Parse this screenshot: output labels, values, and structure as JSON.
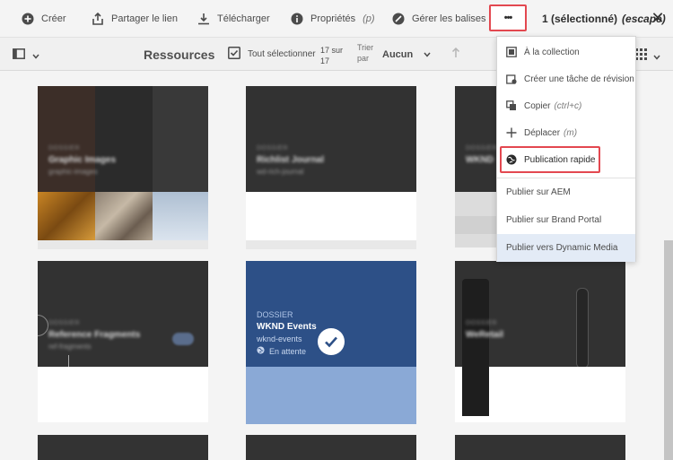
{
  "actionbar": {
    "create": "Créer",
    "share": "Partager le lien",
    "download": "Télécharger",
    "properties": "Propriétés",
    "properties_hint": "(p)",
    "tags": "Gérer les balises",
    "more": "•••",
    "selection": "1 (sélectionné)",
    "escape_hint": "(escape)",
    "close": "✕"
  },
  "toolbar": {
    "title": "Ressources",
    "select_all": "Tout sélectionner",
    "count": "17 sur 17",
    "sort_label": "Trier par",
    "sort_value": "Aucun"
  },
  "cards": [
    {
      "type": "DOSSIER",
      "name": "Graphic Images",
      "sub": "graphic-images"
    },
    {
      "type": "DOSSIER",
      "name": "Richlist Journal",
      "sub": "wd-rich-journal"
    },
    {
      "type": "DOSSIER",
      "name": "WKND",
      "sub": ""
    },
    {
      "type": "DOSSIER",
      "name": "Reference Fragments",
      "sub": "ref-fragments"
    },
    {
      "type": "DOSSIER",
      "name": "WKND Events",
      "sub": "wknd-events",
      "status": "En attente"
    },
    {
      "type": "DOSSIER",
      "name": "WeRetail",
      "sub": ""
    }
  ],
  "menu": {
    "items": [
      {
        "label": "À la collection",
        "hint": "",
        "icon": "collection-icon"
      },
      {
        "label": "Créer une tâche de révision",
        "hint": "",
        "icon": "review-task-icon"
      },
      {
        "label": "Copier",
        "hint": "(ctrl+c)",
        "icon": "copy-icon"
      },
      {
        "label": "Déplacer",
        "hint": "(m)",
        "icon": "move-icon"
      },
      {
        "label": "Publication rapide",
        "hint": "",
        "icon": "globe-icon"
      }
    ],
    "publish": [
      {
        "label": "Publier sur AEM"
      },
      {
        "label": "Publier sur Brand Portal"
      },
      {
        "label": "Publier vers Dynamic Media"
      }
    ]
  },
  "colors": {
    "highlight": "#e34850",
    "folder_selected": "#2d5087",
    "menu_hover": "#e3ebf6"
  }
}
